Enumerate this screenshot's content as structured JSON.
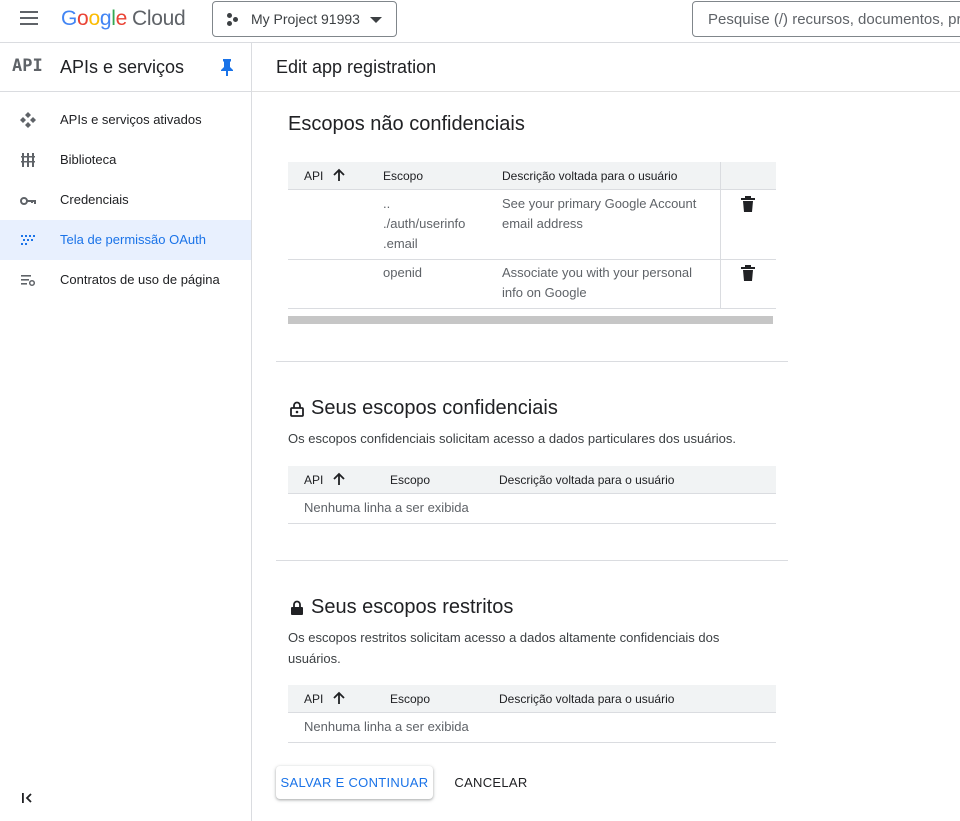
{
  "topbar": {
    "logo_parts": [
      "G",
      "o",
      "o",
      "g",
      "l",
      "e"
    ],
    "logo_cloud": "Cloud",
    "project_name": "My Project 91993",
    "search_placeholder": "Pesquise (/) recursos, documentos, produtos e mais"
  },
  "sidebar": {
    "api_logo": "API",
    "title": "APIs e serviços",
    "items": [
      {
        "label": "APIs e serviços ativados",
        "icon": "apis-icon",
        "active": false
      },
      {
        "label": "Biblioteca",
        "icon": "library-icon",
        "active": false
      },
      {
        "label": "Credenciais",
        "icon": "key-icon",
        "active": false
      },
      {
        "label": "Tela de permissão OAuth",
        "icon": "oauth-consent-icon",
        "active": true
      },
      {
        "label": "Contratos de uso de página",
        "icon": "page-usage-icon",
        "active": false
      }
    ],
    "collapse_icon": "collapse-sidebar-icon"
  },
  "main": {
    "page_title": "Edit app registration",
    "nonsensitive": {
      "title": "Escopos não confidenciais",
      "columns": [
        "API",
        "Escopo",
        "Descrição voltada para o usuário"
      ],
      "rows": [
        {
          "scope": "..\n./auth/userinfo\n.email",
          "description": "See your primary Google Account email address"
        },
        {
          "scope": "openid",
          "description": "Associate you with your personal info on Google"
        }
      ]
    },
    "sensitive": {
      "title": "Seus escopos confidenciais",
      "description": "Os escopos confidenciais solicitam acesso a dados particulares dos usuários.",
      "columns": [
        "API",
        "Escopo",
        "Descrição voltada para o usuário"
      ],
      "empty_text": "Nenhuma linha a ser exibida"
    },
    "restricted": {
      "title": "Seus escopos restritos",
      "description": "Os escopos restritos solicitam acesso a dados altamente confidenciais dos usuários.",
      "columns": [
        "API",
        "Escopo",
        "Descrição voltada para o usuário"
      ],
      "empty_text": "Nenhuma linha a ser exibida"
    },
    "actions": {
      "save_label": "SALVAR E CONTINUAR",
      "cancel_label": "CANCELAR"
    }
  },
  "colors": {
    "accent": "#1a73e8",
    "active_bg": "#e8f0fe",
    "border": "#dadce0",
    "header_bg": "#f1f3f4"
  }
}
